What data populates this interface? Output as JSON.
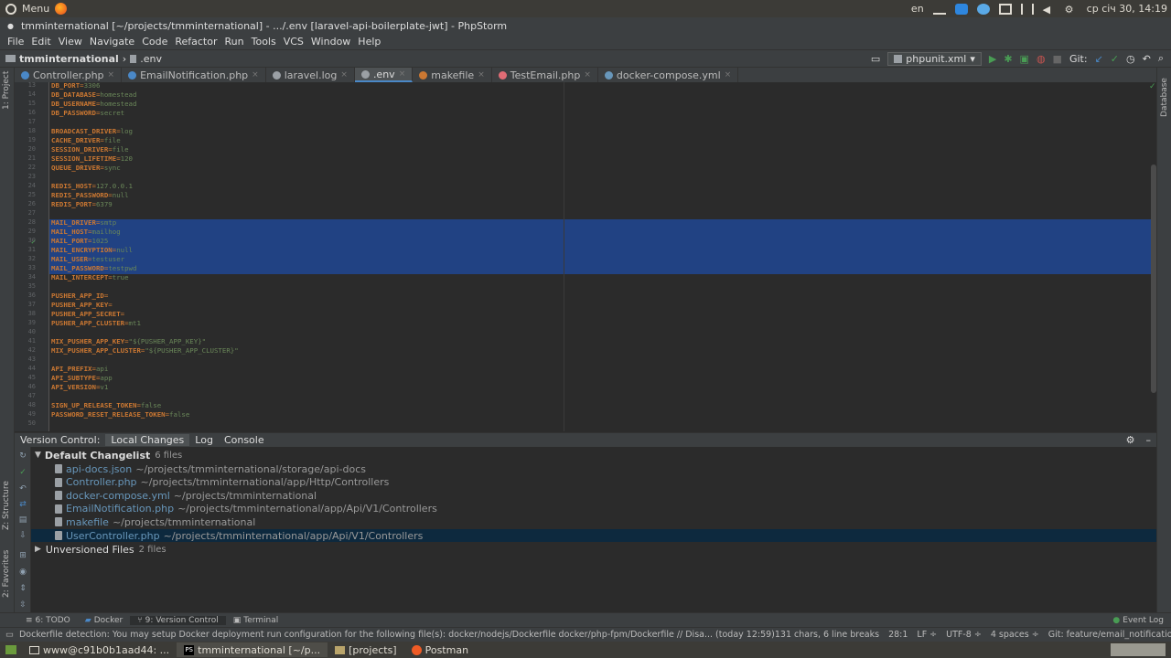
{
  "os": {
    "menu_label": "Menu",
    "keyboard_layout": "en",
    "clock": "ср січ 30, 14:19"
  },
  "window": {
    "title": "tmminternational [~/projects/tmminternational] - .../.env [laravel-api-boilerplate-jwt] - PhpStorm"
  },
  "menu": [
    "File",
    "Edit",
    "View",
    "Navigate",
    "Code",
    "Refactor",
    "Run",
    "Tools",
    "VCS",
    "Window",
    "Help"
  ],
  "nav": {
    "project": "tmminternational",
    "file": ".env",
    "run_config": "phpunit.xml",
    "git_label": "Git:"
  },
  "tabs": [
    {
      "label": "Controller.php",
      "color": "#4a88c7",
      "active": false
    },
    {
      "label": "EmailNotification.php",
      "color": "#4a88c7",
      "active": false
    },
    {
      "label": "laravel.log",
      "color": "#9ba0a5",
      "active": false
    },
    {
      "label": ".env",
      "color": "#9ba0a5",
      "active": true
    },
    {
      "label": "makefile",
      "color": "#cc7832",
      "active": false
    },
    {
      "label": "TestEmail.php",
      "color": "#e06c75",
      "active": false
    },
    {
      "label": "docker-compose.yml",
      "color": "#6897bb",
      "active": false
    }
  ],
  "side_labels": {
    "project": "1: Project",
    "structure": "Z: Structure",
    "favorites": "2: Favorites",
    "database": "Database"
  },
  "code_lines": [
    {
      "n": "13",
      "k": "DB_PORT",
      "v": "3306"
    },
    {
      "n": "14",
      "k": "DB_DATABASE",
      "v": "homestead"
    },
    {
      "n": "15",
      "k": "DB_USERNAME",
      "v": "homestead"
    },
    {
      "n": "16",
      "k": "DB_PASSWORD",
      "v": "secret"
    },
    {
      "n": "17",
      "k": "",
      "v": ""
    },
    {
      "n": "18",
      "k": "BROADCAST_DRIVER",
      "v": "log"
    },
    {
      "n": "19",
      "k": "CACHE_DRIVER",
      "v": "file"
    },
    {
      "n": "20",
      "k": "SESSION_DRIVER",
      "v": "file"
    },
    {
      "n": "21",
      "k": "SESSION_LIFETIME",
      "v": "120"
    },
    {
      "n": "22",
      "k": "QUEUE_DRIVER",
      "v": "sync"
    },
    {
      "n": "23",
      "k": "",
      "v": ""
    },
    {
      "n": "24",
      "k": "REDIS_HOST",
      "v": "127.0.0.1"
    },
    {
      "n": "25",
      "k": "REDIS_PASSWORD",
      "v": "null"
    },
    {
      "n": "26",
      "k": "REDIS_PORT",
      "v": "6379"
    },
    {
      "n": "27",
      "k": "",
      "v": ""
    },
    {
      "n": "28",
      "k": "MAIL_DRIVER",
      "v": "smtp"
    },
    {
      "n": "29",
      "k": "MAIL_HOST",
      "v": "mailhog"
    },
    {
      "n": "30",
      "k": "MAIL_PORT",
      "v": "1025"
    },
    {
      "n": "31",
      "k": "MAIL_ENCRYPTION",
      "v": "null"
    },
    {
      "n": "32",
      "k": "MAIL_USER",
      "v": "testuser"
    },
    {
      "n": "33",
      "k": "MAIL_PASSWORD",
      "v": "testpwd"
    },
    {
      "n": "34",
      "k": "MAIL_INTERCEPT",
      "v": "true"
    },
    {
      "n": "35",
      "k": "",
      "v": ""
    },
    {
      "n": "36",
      "k": "PUSHER_APP_ID",
      "v": ""
    },
    {
      "n": "37",
      "k": "PUSHER_APP_KEY",
      "v": ""
    },
    {
      "n": "38",
      "k": "PUSHER_APP_SECRET",
      "v": ""
    },
    {
      "n": "39",
      "k": "PUSHER_APP_CLUSTER",
      "v": "mt1"
    },
    {
      "n": "40",
      "k": "",
      "v": ""
    },
    {
      "n": "41",
      "k": "MIX_PUSHER_APP_KEY",
      "v": "\"${PUSHER_APP_KEY}\""
    },
    {
      "n": "42",
      "k": "MIX_PUSHER_APP_CLUSTER",
      "v": "\"${PUSHER_APP_CLUSTER}\""
    },
    {
      "n": "43",
      "k": "",
      "v": ""
    },
    {
      "n": "44",
      "k": "API_PREFIX",
      "v": "api"
    },
    {
      "n": "45",
      "k": "API_SUBTYPE",
      "v": "app"
    },
    {
      "n": "46",
      "k": "API_VERSION",
      "v": "v1"
    },
    {
      "n": "47",
      "k": "",
      "v": ""
    },
    {
      "n": "48",
      "k": "SIGN_UP_RELEASE_TOKEN",
      "v": "false"
    },
    {
      "n": "49",
      "k": "PASSWORD_RESET_RELEASE_TOKEN",
      "v": "false"
    },
    {
      "n": "50",
      "k": "",
      "v": ""
    }
  ],
  "vc": {
    "title": "Version Control:",
    "tabs": [
      "Local Changes",
      "Log",
      "Console"
    ],
    "changelist_label": "Default Changelist",
    "changelist_count": "6 files",
    "files": [
      {
        "name": "api-docs.json",
        "path": "~/projects/tmminternational/storage/api-docs"
      },
      {
        "name": "Controller.php",
        "path": "~/projects/tmminternational/app/Http/Controllers"
      },
      {
        "name": "docker-compose.yml",
        "path": "~/projects/tmminternational"
      },
      {
        "name": "EmailNotification.php",
        "path": "~/projects/tmminternational/app/Api/V1/Controllers"
      },
      {
        "name": "makefile",
        "path": "~/projects/tmminternational"
      },
      {
        "name": "UserController.php",
        "path": "~/projects/tmminternational/app/Api/V1/Controllers"
      }
    ],
    "unversioned_label": "Unversioned Files",
    "unversioned_count": "2 files"
  },
  "bottom_tabs": {
    "todo": "6: TODO",
    "docker": "Docker",
    "version_control": "9: Version Control",
    "terminal": "Terminal",
    "event_log": "Event Log"
  },
  "status": {
    "message": "Dockerfile detection: You may setup Docker deployment run configuration for the following file(s): docker/nodejs/Dockerfile docker/php-fpm/Dockerfile // Disa... (today 12:59)",
    "chars": "131 chars, 6 line breaks",
    "position": "28:1",
    "line_sep": "LF ÷",
    "encoding": "UTF-8 ÷",
    "indent": "4 spaces ÷",
    "git_branch": "Git: feature/email_notification ÷"
  },
  "taskbar": [
    {
      "label": "www@c91b0b1aad44: ...",
      "active": false
    },
    {
      "label": "tmminternational [~/p...",
      "active": true
    },
    {
      "label": "[projects]",
      "active": false
    },
    {
      "label": "Postman",
      "active": false
    }
  ]
}
